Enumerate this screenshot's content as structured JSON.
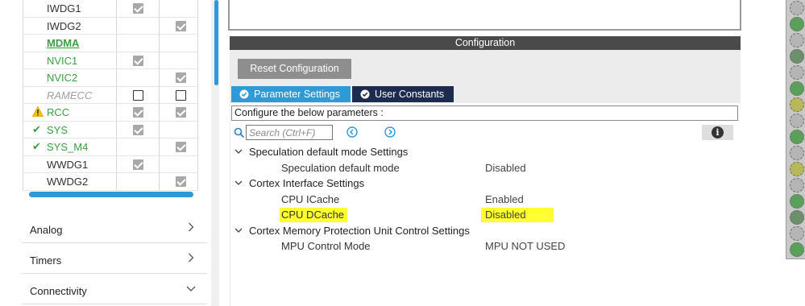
{
  "peripherals": [
    {
      "name": "IWDG1",
      "status": "",
      "style": "normal",
      "mode_a": "checked",
      "mode_b": "none"
    },
    {
      "name": "IWDG2",
      "status": "",
      "style": "normal",
      "mode_a": "none",
      "mode_b": "checked"
    },
    {
      "name": "MDMA",
      "status": "",
      "style": "mdma",
      "mode_a": "none",
      "mode_b": "none"
    },
    {
      "name": "NVIC1",
      "status": "",
      "style": "green",
      "mode_a": "checked",
      "mode_b": "none"
    },
    {
      "name": "NVIC2",
      "status": "",
      "style": "green",
      "mode_a": "none",
      "mode_b": "checked"
    },
    {
      "name": "RAMECC",
      "status": "",
      "style": "disabled",
      "mode_a": "unchecked",
      "mode_b": "unchecked"
    },
    {
      "name": "RCC",
      "status": "warning",
      "style": "green",
      "mode_a": "checked",
      "mode_b": "checked"
    },
    {
      "name": "SYS",
      "status": "ok",
      "style": "green",
      "mode_a": "checked",
      "mode_b": "none"
    },
    {
      "name": "SYS_M4",
      "status": "ok",
      "style": "green",
      "mode_a": "none",
      "mode_b": "checked"
    },
    {
      "name": "WWDG1",
      "status": "",
      "style": "normal",
      "mode_a": "checked",
      "mode_b": "none"
    },
    {
      "name": "WWDG2",
      "status": "",
      "style": "normal",
      "mode_a": "none",
      "mode_b": "checked"
    }
  ],
  "categories": [
    {
      "label": "Analog",
      "arrow": "right"
    },
    {
      "label": "Timers",
      "arrow": "right"
    },
    {
      "label": "Connectivity",
      "arrow": "down"
    }
  ],
  "config": {
    "header": "Configuration",
    "reset_label": "Reset Configuration",
    "tabs": {
      "parameter_settings": "Parameter Settings",
      "user_constants": "User Constants"
    },
    "configure_text": "Configure the below parameters :",
    "search_placeholder": "Search (Ctrl+F)",
    "info_label": "i"
  },
  "param_tree": [
    {
      "group": "Speculation default mode Settings",
      "params": [
        {
          "name": "Speculation default mode",
          "value": "Disabled",
          "highlighted": false
        }
      ]
    },
    {
      "group": "Cortex Interface Settings",
      "params": [
        {
          "name": "CPU ICache",
          "value": "Enabled",
          "highlighted": false
        },
        {
          "name": "CPU DCache",
          "value": "Disabled",
          "highlighted": true
        }
      ]
    },
    {
      "group": "Cortex Memory Protection Unit Control Settings",
      "params": [
        {
          "name": "MPU Control Mode",
          "value": "MPU NOT USED",
          "highlighted": false
        }
      ]
    }
  ],
  "colors": {
    "accent_blue": "#2e9ad8",
    "dark_tab": "#1d2b4f",
    "status_green": "#3aa040",
    "warning_yellow": "#f2c400",
    "highlight": "#ffff33",
    "header_gray": "#4a4a4a"
  },
  "icons": {
    "ok_status": "checkmark-icon",
    "warning_status": "warning-triangle-icon",
    "search": "magnifier-icon",
    "prev": "circle-chevron-left-icon",
    "next": "circle-chevron-right-icon",
    "info": "info-icon",
    "tab_check": "circle-check-icon"
  }
}
